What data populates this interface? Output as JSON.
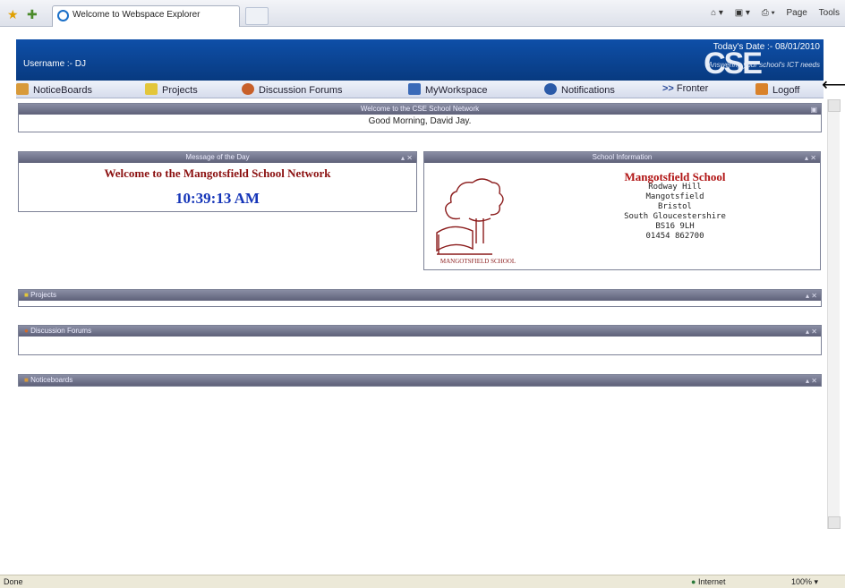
{
  "browser": {
    "tab_title": "Welcome to Webspace Explorer",
    "commands": [
      "Page",
      "Tools"
    ],
    "status_text": "Done",
    "zone": "Internet",
    "zoom": "100%"
  },
  "header": {
    "username": "Username :- DJ",
    "today": "Today's Date :- 08/01/2010",
    "logo": "CSE",
    "tagline": "Answering your school's ICT needs"
  },
  "nav": [
    {
      "label": "NoticeBoards",
      "icon": "noticeboard-icon"
    },
    {
      "label": "Projects",
      "icon": "folder-icon"
    },
    {
      "label": "Discussion Forums",
      "icon": "discussion-icon"
    },
    {
      "label": "MyWorkspace",
      "icon": "workspace-icon"
    },
    {
      "label": "Notifications",
      "icon": "info-icon"
    },
    {
      "label": "Fronter",
      "icon": "chevron-right-icon"
    },
    {
      "label": "Logoff",
      "icon": "logoff-icon"
    }
  ],
  "welcome": {
    "title": "Welcome to the CSE School Network",
    "greeting": "Good Morning, David Jay."
  },
  "motd": {
    "title": "Message of the Day",
    "text": "Welcome to the Mangotsfield School Network",
    "time": "10:39:13 AM"
  },
  "school": {
    "title": "School Information",
    "name": "Mangotsfield School",
    "address": [
      "Rodway Hill",
      "Mangotsfield",
      "Bristol",
      "South Gloucestershire",
      "BS16 9LH",
      "01454 862700"
    ],
    "crest_caption": "MANGOTSFIELD SCHOOL"
  },
  "panels": {
    "projects": "Projects",
    "forums": "Discussion Forums",
    "noticeboards": "Noticeboards"
  },
  "colors": {
    "header_blue": "#0e4fa8",
    "school_red": "#b11515",
    "motd_red": "#8b1010",
    "time_blue": "#1535b8"
  }
}
